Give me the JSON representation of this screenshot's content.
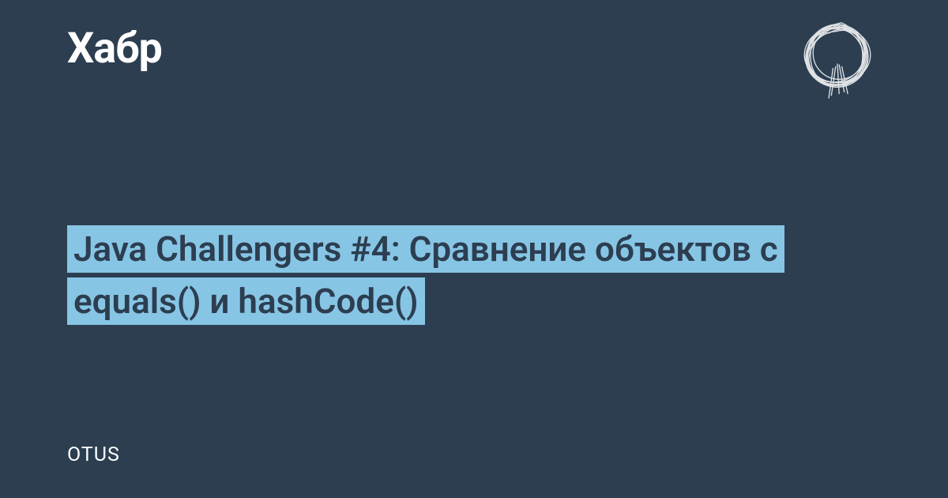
{
  "header": {
    "logo": "Хабр",
    "icon_name": "scribble-icon"
  },
  "article": {
    "title": "Java Challengers #4: Сравнение объектов с equals() и hashCode()",
    "author": "OTUS"
  },
  "colors": {
    "background": "#2c3e50",
    "highlight": "#87c5e5",
    "text_light": "#ffffff"
  }
}
